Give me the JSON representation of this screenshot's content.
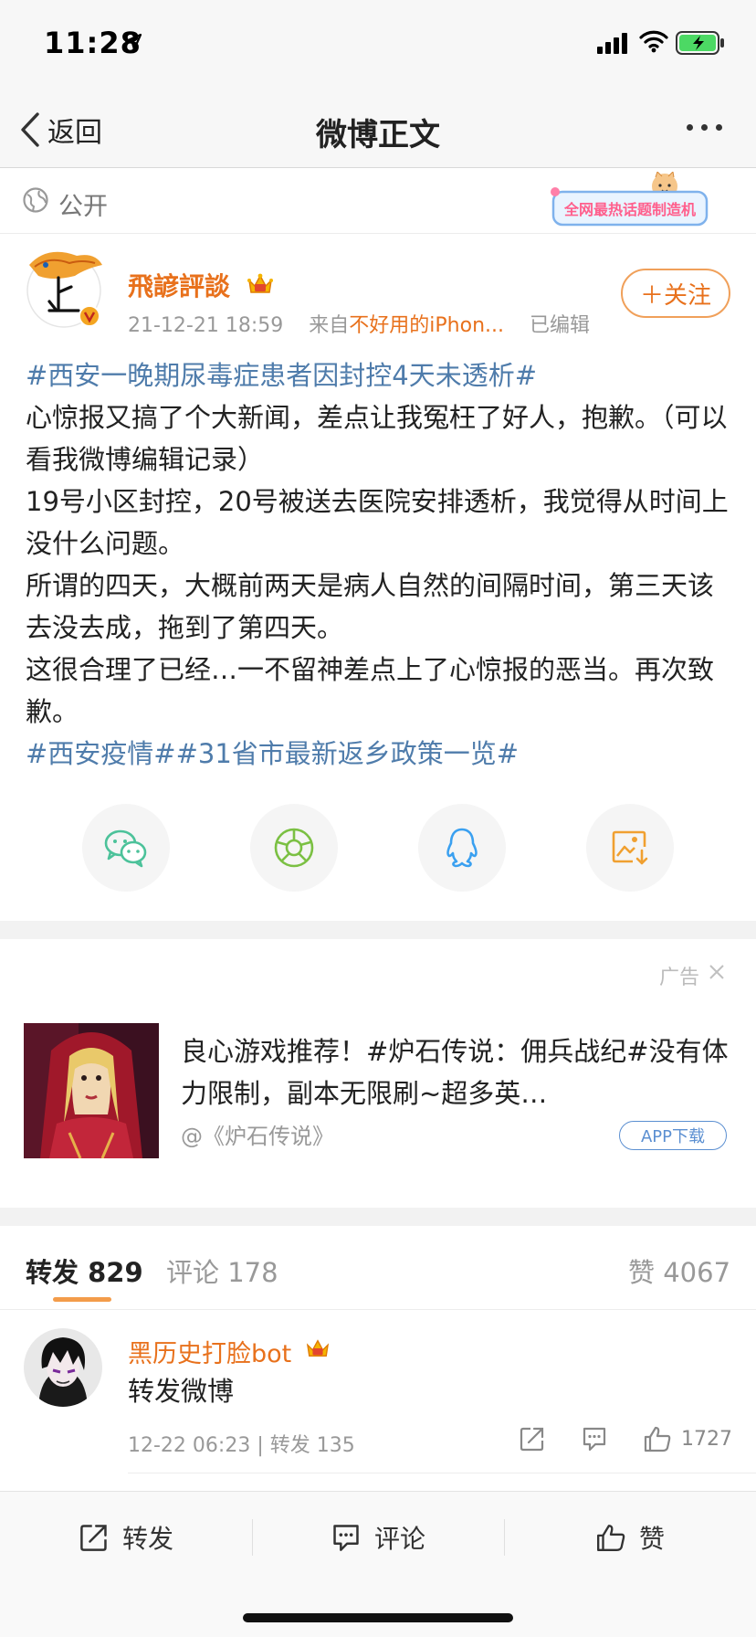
{
  "status_bar": {
    "time": "11:28"
  },
  "nav": {
    "back_label": "返回",
    "title": "微博正文"
  },
  "visibility": {
    "label": "公开"
  },
  "topic_badge": {
    "label": "全网最热话题制造机"
  },
  "post": {
    "author": "飛諺評談",
    "timestamp": "21-12-21 18:59",
    "source_prefix": "来自",
    "source": "不好用的iPhon...",
    "edited": "已编辑",
    "follow_label": "＋关注",
    "body": [
      {
        "hashtag": "#西安一晚期尿毒症患者因封控4天未透析#",
        "text": ""
      },
      {
        "hashtag": "",
        "text": "心惊报又搞了个大新闻，差点让我冤枉了好人，抱歉。（可以看我微博编辑记录）"
      },
      {
        "hashtag": "",
        "text": "19号小区封控，20号被送去医院安排透析，我觉得从时间上没什么问题。"
      },
      {
        "hashtag": "",
        "text": "所谓的四天，大概前两天是病人自然的间隔时间，第三天该去没去成，拖到了第四天。"
      },
      {
        "hashtag": "",
        "text": "这很合理了已经…一不留神差点上了心惊报的恶当。再次致歉。"
      },
      {
        "hashtag": "#西安疫情##31省市最新返乡政策一览#",
        "text": ""
      }
    ]
  },
  "ad": {
    "tag": "广告",
    "title": "良心游戏推荐！#炉石传说：佣兵战纪#没有体力限制，副本无限刷~超多英…",
    "sponsor": "@《炉石传说》",
    "download_label": "APP下载"
  },
  "tabs": {
    "repost": "转发 829",
    "comment": "评论 178",
    "like": "赞 4067"
  },
  "repost_item": {
    "user": "黑历史打脸bot",
    "text": "转发微博",
    "meta": "12-22 06:23 | 转发 135",
    "likes": "1727"
  },
  "bottom_bar": {
    "repost": "转发",
    "comment": "评论",
    "like": "赞"
  },
  "colors": {
    "accent_orange": "#e8711c",
    "hashtag_blue": "#4f7cab",
    "vip_gold": "#f5b400"
  },
  "icons": [
    "location-arrow-icon",
    "signal-icon",
    "wifi-icon",
    "battery-icon",
    "back-chevron-icon",
    "more-dots-icon",
    "globe-icon",
    "crown-icon",
    "wechat-icon",
    "moments-icon",
    "qq-icon",
    "save-image-icon",
    "close-icon",
    "share-icon",
    "comment-icon",
    "thumbs-up-icon"
  ]
}
